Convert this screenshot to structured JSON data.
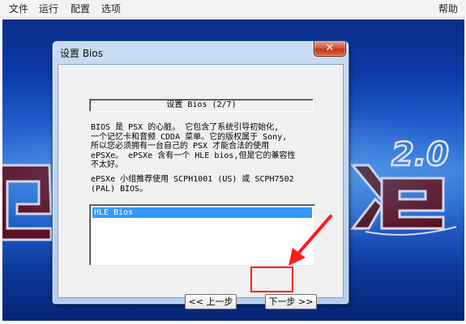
{
  "menubar": {
    "items": [
      "文件",
      "运行",
      "配置",
      "选项"
    ],
    "help": "帮助"
  },
  "dialog": {
    "title": "设置 Bios",
    "close_glyph": "✕",
    "step_header": "设置 Bios (2/7)",
    "description_lines": [
      "BIOS 是 PSX 的心脏。 它包含了系统引导初始化,",
      "一个记忆卡和音频 CDDA 菜单。它的版权属于 Sony,",
      "所以您必须拥有一台自己的 PSX 才能合法的使用",
      "ePSXe。 ePSXe 含有一个 HLE bios,但是它的兼容性",
      "不太好。"
    ],
    "recommendation_lines": [
      "ePSXe 小组推荐使用 SCPH1001 (US) 或 SCPH7502",
      "(PAL) BIOS。"
    ],
    "bios_list": [
      "HLE Bios"
    ],
    "prev_button": "<< 上一步",
    "next_button": "下一步 >>"
  },
  "background": {
    "logo_text": "2.0"
  },
  "colors": {
    "selection": "#3399ff",
    "highlight_box": "#ff1a1a",
    "arrow": "#ff1a1a",
    "close_button": "#c2371a"
  },
  "icons": [
    "close-icon",
    "annotation-arrow"
  ]
}
